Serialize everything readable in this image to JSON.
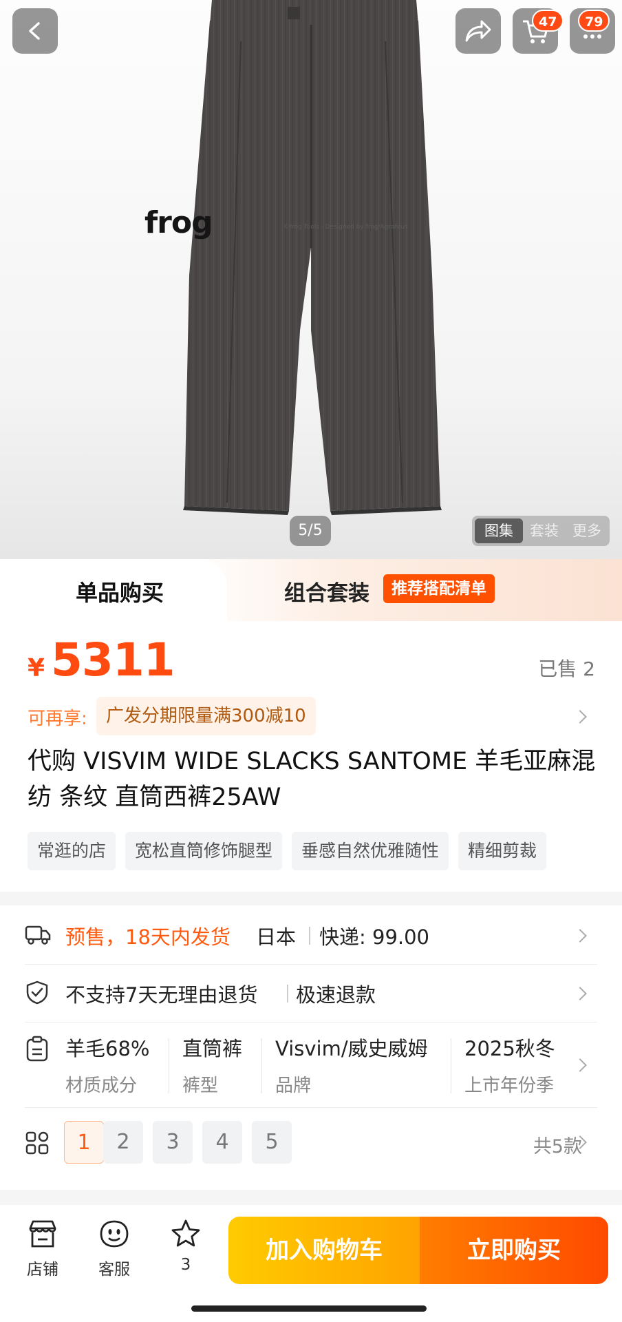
{
  "header": {
    "cart_count": "47",
    "message_count": "79"
  },
  "gallery": {
    "watermark_logo": "frog",
    "watermark_caption": "©frog Tools · Designed by frog/Agrafeus",
    "counter": "5/5",
    "tabs": [
      "图集",
      "套装",
      "更多"
    ],
    "active_tab": 0
  },
  "buy_tabs": {
    "single": "单品购买",
    "combo": "组合套装",
    "combo_tag": "推荐搭配清单"
  },
  "price": {
    "symbol": "¥",
    "value": "5311",
    "sold": "已售 2"
  },
  "promo": {
    "label": "可再享:",
    "offer": "广发分期限量满300减10"
  },
  "product": {
    "title": "代购 VISVIM WIDE SLACKS SANTOME 羊毛亚麻混纺 条纹 直筒西裤25AW",
    "tags": [
      "常逛的店",
      "宽松直筒修饰腿型",
      "垂感自然优雅随性",
      "精细剪裁"
    ]
  },
  "shipping": {
    "presale": "预售，18天内发货",
    "origin": "日本",
    "express": "快递: 99.00"
  },
  "returns": {
    "policy": "不支持7天无理由退货",
    "fast_refund": "极速退款"
  },
  "attributes": [
    {
      "value": "羊毛68%",
      "key": "材质成分"
    },
    {
      "value": "直筒裤",
      "key": "裤型"
    },
    {
      "value": "Visvim/威史威姆",
      "key": "品牌"
    },
    {
      "value": "2025秋冬",
      "key": "上市年份季"
    }
  ],
  "sku": {
    "options": [
      "1",
      "2",
      "3",
      "4",
      "5"
    ],
    "selected": "1",
    "total": "共5款"
  },
  "bottom_bar": {
    "shop": "店铺",
    "service": "客服",
    "favorites": "3",
    "add_to_cart": "加入购物车",
    "buy_now": "立即购买"
  },
  "colors": {
    "accent": "#ff4a10",
    "cart_button": "#ffb300",
    "buy_button": "#ff5a00",
    "pants": "#4a4747"
  }
}
